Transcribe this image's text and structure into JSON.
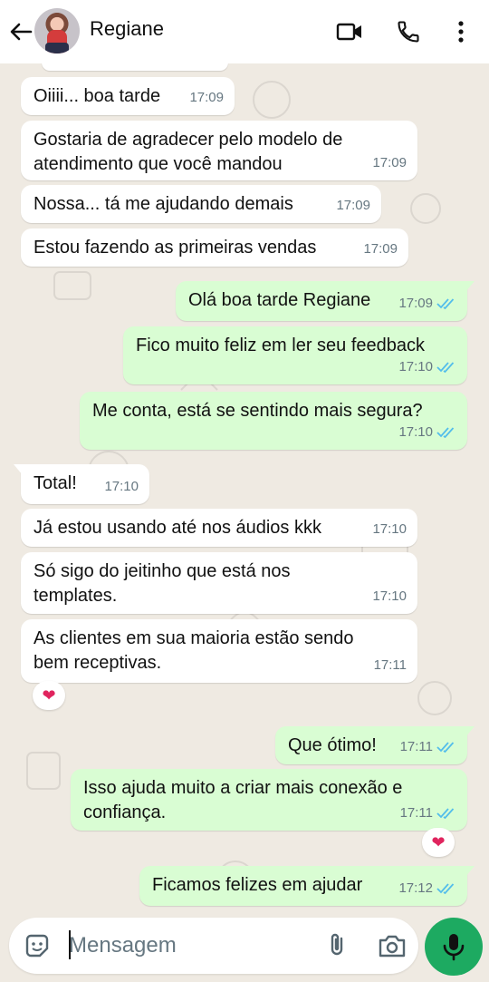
{
  "header": {
    "contact_name": "Regiane",
    "icons": [
      "back-arrow-icon",
      "avatar",
      "video-call-icon",
      "voice-call-icon",
      "more-options-icon"
    ]
  },
  "messages": [
    {
      "dir": "in",
      "lines": [
        "Oiiii... boa tarde"
      ],
      "time": "17:09"
    },
    {
      "dir": "in",
      "lines": [
        "Gostaria de agradecer pelo modelo de",
        "atendimento que você mandou"
      ],
      "time": "17:09"
    },
    {
      "dir": "in",
      "lines": [
        "Nossa... tá me ajudando demais"
      ],
      "time": "17:09"
    },
    {
      "dir": "in",
      "lines": [
        "Estou fazendo as primeiras vendas"
      ],
      "time": "17:09"
    },
    {
      "dir": "out",
      "lines": [
        "Olá boa tarde Regiane"
      ],
      "time": "17:09",
      "read": true
    },
    {
      "dir": "out",
      "lines": [
        "Fico muito feliz em ler seu feedback"
      ],
      "time": "17:10",
      "read": true
    },
    {
      "dir": "out",
      "lines": [
        "Me conta, está se sentindo mais segura?"
      ],
      "time": "17:10",
      "read": true
    },
    {
      "dir": "in",
      "lines": [
        "Total!"
      ],
      "time": "17:10"
    },
    {
      "dir": "in",
      "lines": [
        "Já estou usando até nos áudios kkk"
      ],
      "time": "17:10"
    },
    {
      "dir": "in",
      "lines": [
        "Só sigo do jeitinho que está nos",
        "templates."
      ],
      "time": "17:10"
    },
    {
      "dir": "in",
      "lines": [
        "As clientes em sua maioria estão sendo",
        "bem receptivas."
      ],
      "time": "17:11",
      "reaction": "❤"
    },
    {
      "dir": "out",
      "lines": [
        "Que ótimo!"
      ],
      "time": "17:11",
      "read": true
    },
    {
      "dir": "out",
      "lines": [
        "Isso ajuda muito a criar mais conexão e",
        "confiança."
      ],
      "time": "17:11",
      "read": true,
      "reaction": "❤"
    },
    {
      "dir": "out",
      "lines": [
        "Ficamos felizes em ajudar"
      ],
      "time": "17:12",
      "read": true
    }
  ],
  "composer": {
    "placeholder": "Mensagem",
    "value": ""
  },
  "colors": {
    "wallpaper": "#efeae2",
    "incoming_bubble": "#ffffff",
    "outgoing_bubble": "#d9fdd3",
    "read_ticks": "#53bdeb",
    "mic_button": "#1daa61",
    "reaction_heart": "#e0245e"
  }
}
